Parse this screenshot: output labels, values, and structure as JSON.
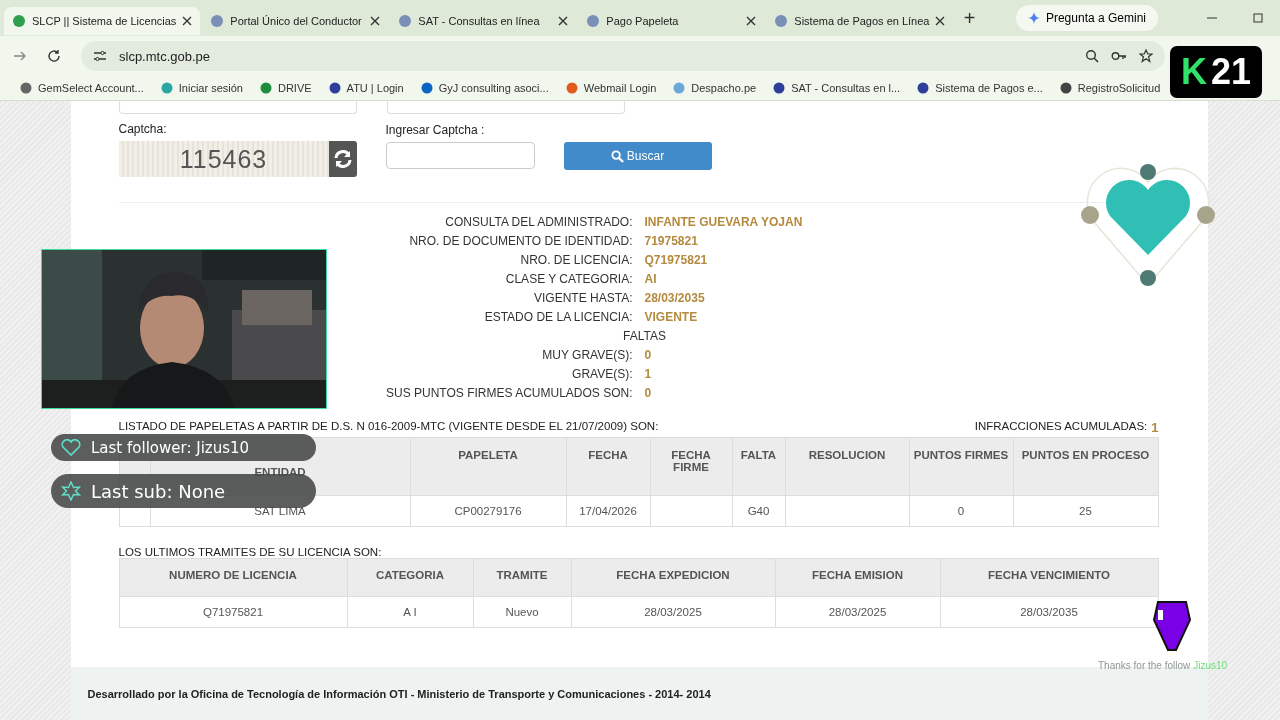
{
  "browser": {
    "tabs": [
      {
        "title": "SLCP || Sistema de Licencias",
        "selected": true
      },
      {
        "title": "Portal Único del Conductor",
        "selected": false
      },
      {
        "title": "SAT - Consultas en línea",
        "selected": false
      },
      {
        "title": "Pago Papeleta",
        "selected": false
      },
      {
        "title": "Sistema de Pagos en Línea",
        "selected": false
      }
    ],
    "new_tab": "+",
    "gemini": "Pregunta a Gemini",
    "url": "slcp.mtc.gob.pe",
    "bookmarks": [
      "GemSelect Account...",
      "Iniciar sesión",
      "DRIVE",
      "ATU | Login",
      "GyJ consulting asoci...",
      "Webmail Login",
      "Despacho.pe",
      "SAT - Consultas en l...",
      "Sistema de Pagos e...",
      "RegistroSolicitud"
    ]
  },
  "logo": {
    "mark": "K",
    "number": "21"
  },
  "search_form": {
    "captcha_label": "Captcha:",
    "captcha_code": "115463",
    "input_label": "Ingresar Captcha :",
    "button": "Buscar"
  },
  "details": [
    {
      "label": "CONSULTA DEL ADMINISTRADO:",
      "value": "INFANTE GUEVARA YOJAN"
    },
    {
      "label": "NRO. DE DOCUMENTO DE IDENTIDAD:",
      "value": "71975821"
    },
    {
      "label": "NRO. DE LICENCIA:",
      "value": "Q71975821"
    },
    {
      "label": "CLASE Y CATEGORIA:",
      "value": "AI"
    },
    {
      "label": "VIGENTE HASTA:",
      "value": "28/03/2035"
    },
    {
      "label": "ESTADO DE LA LICENCIA:",
      "value": "VIGENTE"
    }
  ],
  "faltas": {
    "title": "FALTAS",
    "rows": [
      {
        "label": "MUY GRAVE(S):",
        "value": "0"
      },
      {
        "label": "GRAVE(S):",
        "value": "1"
      },
      {
        "label": "SUS PUNTOS FIRMES ACUMULADOS SON:",
        "value": "0"
      }
    ]
  },
  "papeletas": {
    "title": "LISTADO DE PAPELETAS A PARTIR DE D.S. N 016-2009-MTC (VIGENTE DESDE EL 21/07/2009) SON:",
    "total_label": "INFRACCIONES ACUMULADAS:",
    "total": "1",
    "columns": [
      "",
      "ENTIDAD",
      "PAPELETA",
      "FECHA",
      "FECHA FIRME",
      "FALTA",
      "RESOLUCION",
      "PUNTOS FIRMES",
      "PUNTOS EN PROCESO"
    ],
    "rows": [
      [
        "",
        "SAT LIMA",
        "CP00279176",
        "17/04/2026",
        "",
        "G40",
        "",
        "0",
        "25"
      ]
    ]
  },
  "tramites": {
    "title": "LOS ULTIMOS TRAMITES DE SU LICENCIA SON:",
    "columns": [
      "NUMERO DE LICENCIA",
      "CATEGORIA",
      "TRAMITE",
      "FECHA EXPEDICION",
      "FECHA EMISION",
      "FECHA VENCIMIENTO"
    ],
    "rows": [
      [
        "Q71975821",
        "A I",
        "Nuevo",
        "28/03/2025",
        "28/03/2025",
        "28/03/2035"
      ]
    ]
  },
  "footer": "Desarrollado por la Oficina de Tecnología de Información OTI - Ministerio de Transporte y Comunicaciones - 2014- 2014",
  "overlay": {
    "last_follower": "Last follower: Jizus10",
    "last_sub": "Last sub: None",
    "thanks": "Thanks for the follow",
    "thanks_name": "Jizus10"
  }
}
